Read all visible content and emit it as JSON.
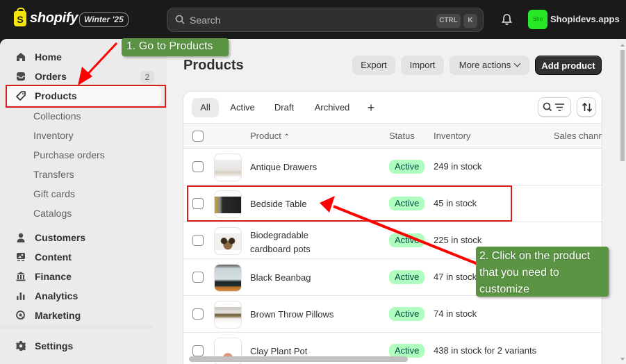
{
  "topbar": {
    "brand": "shopify",
    "edition": "Winter '25",
    "search_placeholder": "Search",
    "shortcut_keys": [
      "CTRL",
      "K"
    ],
    "store_avatar": "Sho",
    "store_name": "Shopidevs.apps"
  },
  "sidebar": {
    "items": [
      {
        "label": "Home",
        "icon": "home-icon"
      },
      {
        "label": "Orders",
        "icon": "inbox-icon",
        "badge": "2"
      },
      {
        "label": "Products",
        "icon": "tag-icon",
        "active": true
      }
    ],
    "sub_items": [
      "Collections",
      "Inventory",
      "Purchase orders",
      "Transfers",
      "Gift cards",
      "Catalogs"
    ],
    "more_items": [
      {
        "label": "Customers",
        "icon": "person-icon"
      },
      {
        "label": "Content",
        "icon": "content-icon"
      },
      {
        "label": "Finance",
        "icon": "bank-icon"
      },
      {
        "label": "Analytics",
        "icon": "bar-chart-icon"
      },
      {
        "label": "Marketing",
        "icon": "target-icon"
      }
    ],
    "settings": "Settings"
  },
  "page": {
    "title": "Products",
    "actions": {
      "export": "Export",
      "import": "Import",
      "more": "More actions",
      "add": "Add product"
    }
  },
  "tabs": [
    "All",
    "Active",
    "Draft",
    "Archived",
    "+"
  ],
  "table": {
    "headers": {
      "product": "Product",
      "status": "Status",
      "inventory": "Inventory",
      "sales": "Sales chann"
    },
    "rows": [
      {
        "name": "Antique Drawers",
        "status": "Active",
        "inventory": "249 in stock"
      },
      {
        "name": "Bedside Table",
        "status": "Active",
        "inventory": "45 in stock"
      },
      {
        "name": "Biodegradable cardboard pots",
        "name_lines": [
          "Biodegradable",
          "cardboard pots"
        ],
        "status": "Active",
        "inventory": "225 in stock"
      },
      {
        "name": "Black Beanbag",
        "status": "Active",
        "inventory": "47 in stock"
      },
      {
        "name": "Brown Throw Pillows",
        "status": "Active",
        "inventory": "74 in stock"
      },
      {
        "name": "Clay Plant Pot",
        "status": "Active",
        "inventory": "438 in stock for 2 variants"
      }
    ]
  },
  "annotations": {
    "step1": "1. Go to Products",
    "step2_lines": [
      "2. Click on the product",
      "that you need to",
      "customize"
    ],
    "colors": {
      "callout": "#5a9443",
      "highlight": "#d91c1c",
      "arrow": "#ff0000"
    }
  }
}
